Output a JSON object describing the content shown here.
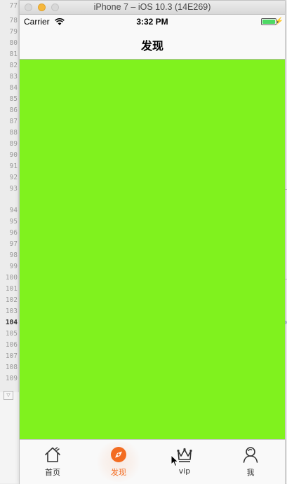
{
  "window": {
    "title": "iPhone 7 – iOS 10.3 (14E269)"
  },
  "editor": {
    "line_numbers": [
      "77",
      "78",
      "79",
      "80",
      "81",
      "82",
      "83",
      "84",
      "85",
      "86",
      "87",
      "88",
      "89",
      "90",
      "91",
      "92",
      "93",
      "94",
      "95",
      "96",
      "97",
      "98",
      "99",
      "100",
      "101",
      "102",
      "103",
      "104",
      "105",
      "106",
      "107",
      "108",
      "109"
    ],
    "current_line": "104",
    "right_fragments": [
      "i",
      "i",
      "o"
    ]
  },
  "status_bar": {
    "carrier": "Carrier",
    "time": "3:32 PM"
  },
  "nav": {
    "title": "发现"
  },
  "content": {
    "background": "#80f21e"
  },
  "tabs": [
    {
      "label": "首页",
      "icon": "home-icon",
      "active": false
    },
    {
      "label": "发现",
      "icon": "discover-icon",
      "active": true
    },
    {
      "label": "vip",
      "icon": "crown-icon",
      "active": false
    },
    {
      "label": "我",
      "icon": "profile-icon",
      "active": false
    }
  ],
  "colors": {
    "accent": "#f36c21",
    "content_green": "#80f21e"
  }
}
